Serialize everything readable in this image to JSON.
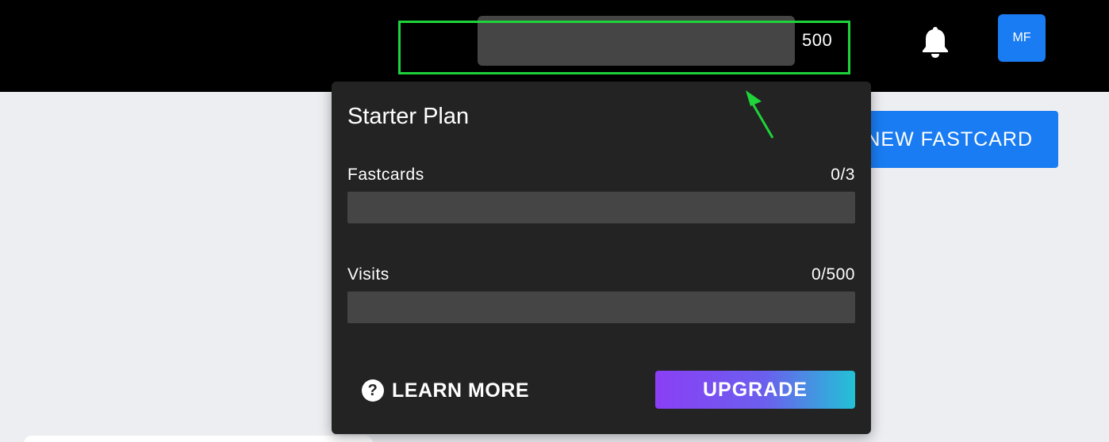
{
  "header": {
    "usage_count": "500",
    "avatar_initials": "MF"
  },
  "actions": {
    "new_fastcard_label": "NEW FASTCARD"
  },
  "plan_popover": {
    "title": "Starter Plan",
    "rows": [
      {
        "label": "Fastcards",
        "value": "0/3",
        "progress": 0
      },
      {
        "label": "Visits",
        "value": "0/500",
        "progress": 0
      }
    ],
    "learn_more_label": "LEARN MORE",
    "upgrade_label": "UPGRADE"
  },
  "icons": {
    "notification": "bell-icon",
    "help": "question-circle-icon",
    "annotation": "arrow-icon"
  },
  "colors": {
    "topbar": "#000000",
    "accent_blue": "#1a7cf2",
    "popover_bg": "#232323",
    "highlight": "#1fd33a",
    "upgrade_gradient": [
      "#8a3ff5",
      "#22c2d6"
    ]
  }
}
